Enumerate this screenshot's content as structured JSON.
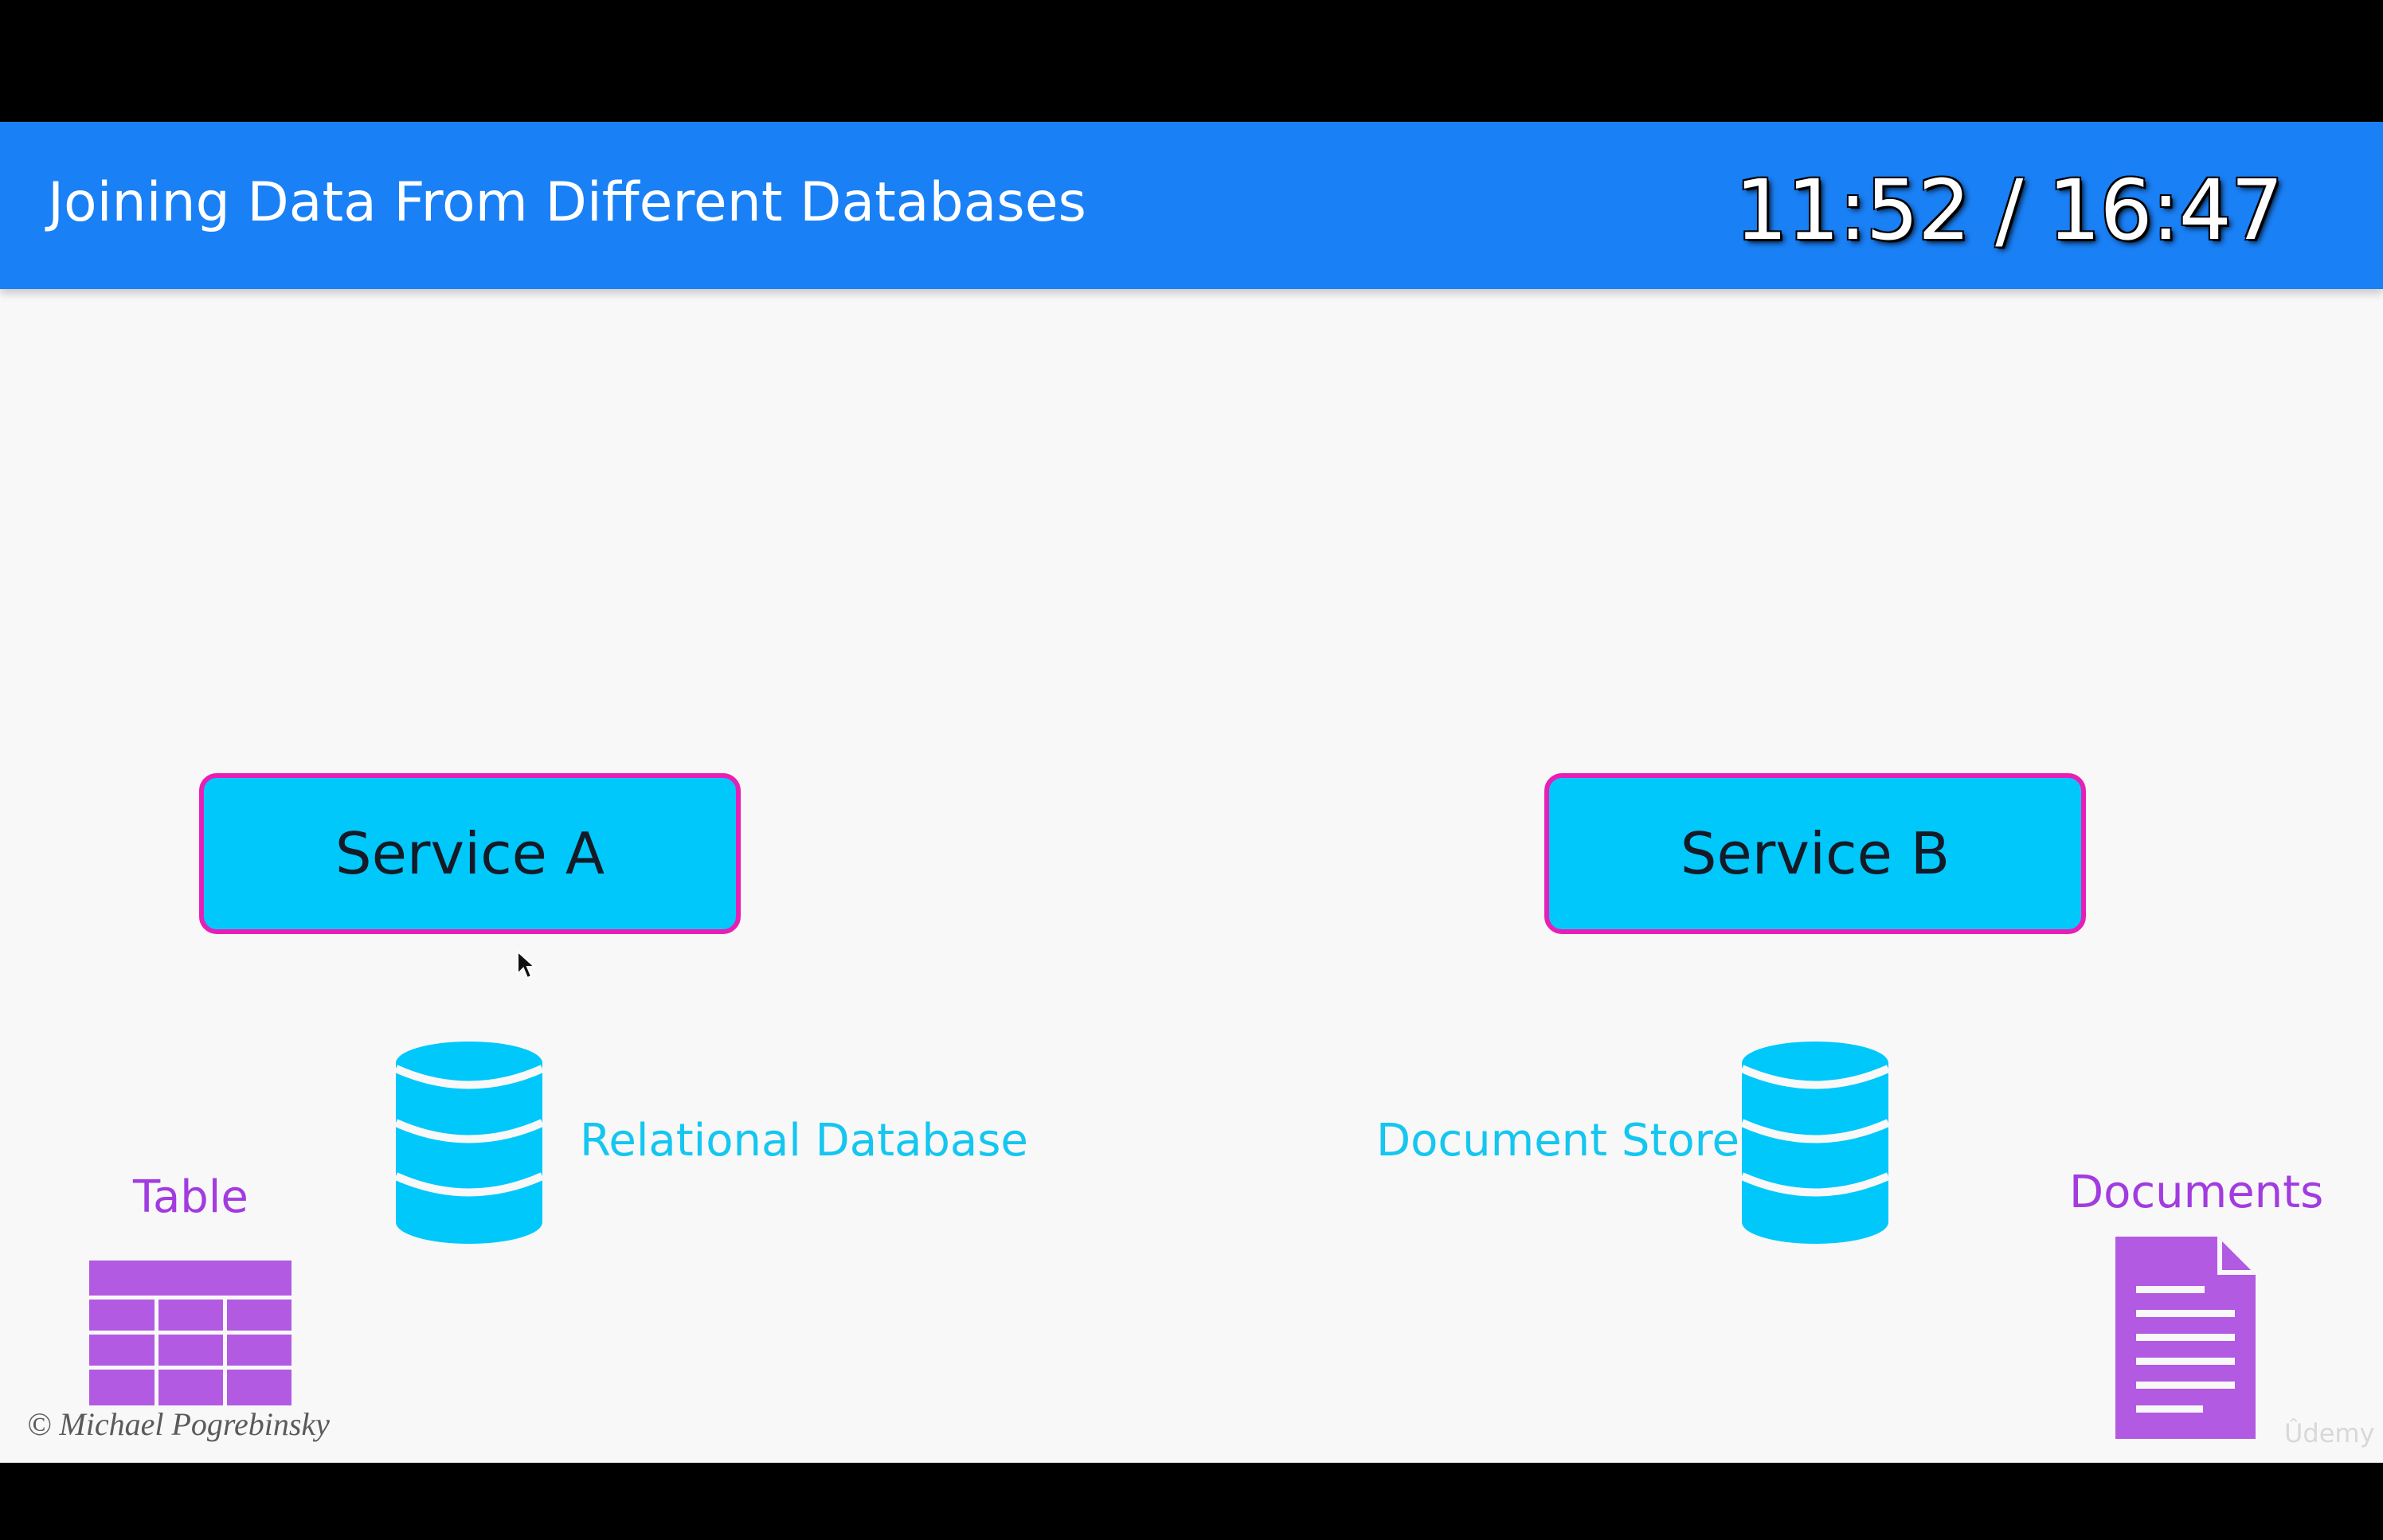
{
  "slide": {
    "title": "Joining Data From Different Databases",
    "timestamp": "11:52 / 16:47"
  },
  "services": {
    "a_label": "Service A",
    "b_label": "Service B"
  },
  "databases": {
    "a_label": "Relational Database",
    "b_label": "Document Store"
  },
  "storage": {
    "table_label": "Table",
    "documents_label": "Documents"
  },
  "footer": {
    "copyright": "© Michael Pogrebinsky",
    "watermark": "Ûdemy"
  },
  "colors": {
    "header_bg": "#1a80f6",
    "service_fill": "#00c8fb",
    "service_border": "#e81fb6",
    "database_fill": "#00c8fb",
    "database_label": "#14c6f0",
    "storage_purple": "#a23be0",
    "slide_bg": "#f8f8f8"
  },
  "icons": {
    "database": "database-cylinder-icon",
    "table": "table-grid-icon",
    "document": "document-page-icon",
    "cursor": "mouse-pointer-icon"
  }
}
